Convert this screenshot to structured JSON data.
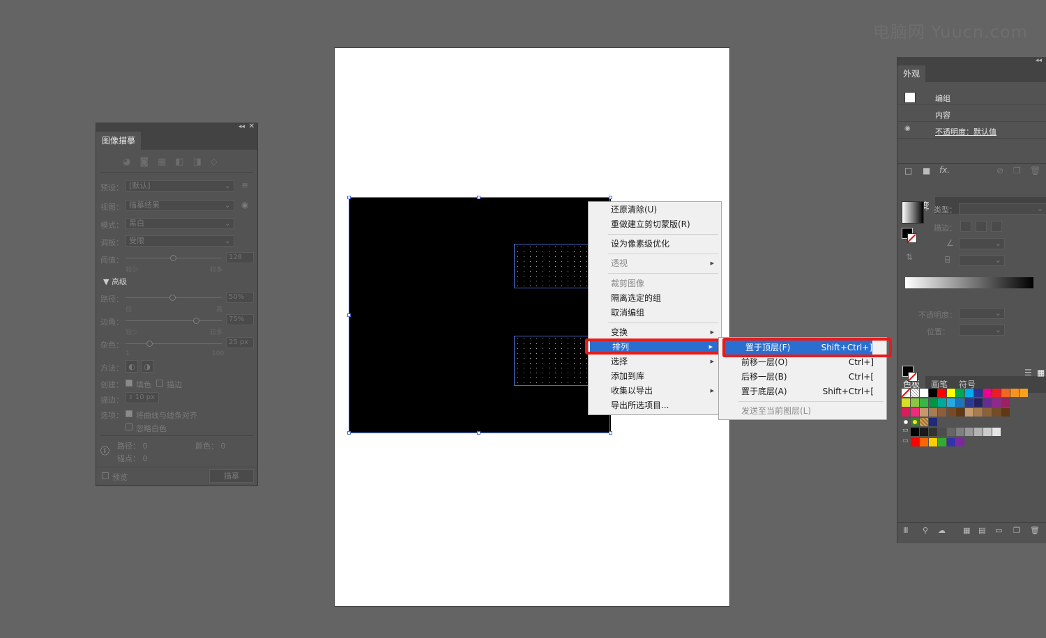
{
  "watermark": "电脑网 Yuucn.com",
  "trace_panel": {
    "title": "图像描摹",
    "preset_label": "预设：",
    "preset_value": "[默认]",
    "view_label": "视图：",
    "view_value": "描摹结果",
    "mode_label": "模式：",
    "mode_value": "黑白",
    "palette_label": "调板：",
    "palette_value": "受限",
    "threshold_label": "阈值：",
    "threshold_value": "128",
    "threshold_min": "较少",
    "threshold_max": "较多",
    "advanced_label": "高级",
    "paths_label": "路径：",
    "paths_value": "50%",
    "paths_min": "低",
    "paths_max": "高",
    "corners_label": "边角：",
    "corners_value": "75%",
    "corners_min": "较少",
    "corners_max": "较多",
    "noise_label": "杂色：",
    "noise_value": "25 px",
    "noise_min": "1",
    "noise_max": "100",
    "method_label": "方法：",
    "create_label": "创建：",
    "fill_label": "填色",
    "stroke_label": "描边",
    "stroke_w_label": "描边：",
    "stroke_w_value": "10 px",
    "options_label": "选项：",
    "snap_label": "将曲线与线条对齐",
    "ignore_white_label": "忽略白色",
    "paths_count_label": "路径：",
    "paths_count": "0",
    "colors_count_label": "颜色：",
    "colors_count": "0",
    "anchors_label": "锚点：",
    "anchors_count": "0",
    "preview_label": "预览",
    "trace_button": "描摹"
  },
  "context_menu": {
    "items": [
      {
        "label": "还原清除(U)",
        "disabled": false
      },
      {
        "label": "重做建立剪切蒙版(R)",
        "disabled": false
      },
      {
        "label": "设为像素级优化",
        "disabled": false
      },
      {
        "label": "透视",
        "disabled": true
      },
      {
        "label": "裁剪图像",
        "disabled": true
      },
      {
        "label": "隔离选定的组",
        "disabled": false
      },
      {
        "label": "取消编组",
        "disabled": false
      },
      {
        "label": "变换",
        "disabled": false
      },
      {
        "label": "排列",
        "disabled": false
      },
      {
        "label": "选择",
        "disabled": false
      },
      {
        "label": "添加到库",
        "disabled": false
      },
      {
        "label": "收集以导出",
        "disabled": false
      },
      {
        "label": "导出所选项目...",
        "disabled": false
      }
    ]
  },
  "arrange_submenu": {
    "items": [
      {
        "label": "置于顶层(F)",
        "shortcut": "Shift+Ctrl+]"
      },
      {
        "label": "前移一层(O)",
        "shortcut": "Ctrl+]"
      },
      {
        "label": "后移一层(B)",
        "shortcut": "Ctrl+["
      },
      {
        "label": "置于底层(A)",
        "shortcut": "Shift+Ctrl+["
      },
      {
        "label": "发送至当前图层(L)",
        "shortcut": ""
      }
    ]
  },
  "appearance_panel": {
    "tab": "外观",
    "group_label": "编组",
    "content_label": "内容",
    "opacity_label": "不透明度：",
    "opacity_value": "默认值",
    "fx_label": "fx."
  },
  "gradient_panel": {
    "tab": "渐变",
    "type_label": "类型：",
    "stroke_label": "描边：",
    "opacity_label": "不透明度：",
    "position_label": "位置："
  },
  "swatches_panel": {
    "tabs": [
      "色板",
      "画笔",
      "符号"
    ],
    "row1": [
      "#ffffff",
      "#000000",
      "#ff0000",
      "#ffff00",
      "#00a651",
      "#00aeef",
      "#2e3192",
      "#ec008c",
      "#ed1c24",
      "#f26522",
      "#f7941d",
      "#f9a11b"
    ],
    "row2": [
      "#d7df23",
      "#8dc63f",
      "#39b54a",
      "#009444",
      "#00a99d",
      "#27aae1",
      "#1c75bc",
      "#2b3990",
      "#262262",
      "#662d91",
      "#92278f",
      "#9e1f63"
    ],
    "row3": [
      "#da1c5c",
      "#ee2a7b",
      "#c49a6c",
      "#a67c52",
      "#8b5e3c",
      "#754c29",
      "#603913",
      "#c69c6d",
      "#a97c50",
      "#8c6239",
      "#754c24",
      "#603813"
    ],
    "row4_gray": [
      "#000000",
      "#1a1a1a",
      "#333333",
      "#4d4d4d",
      "#666666",
      "#808080",
      "#999999",
      "#b3b3b3",
      "#cccccc",
      "#e6e6e6"
    ],
    "row5": [
      "#ff0000",
      "#ff6600",
      "#ffcc00",
      "#33aa33",
      "#3333aa",
      "#7a2a9a"
    ]
  }
}
